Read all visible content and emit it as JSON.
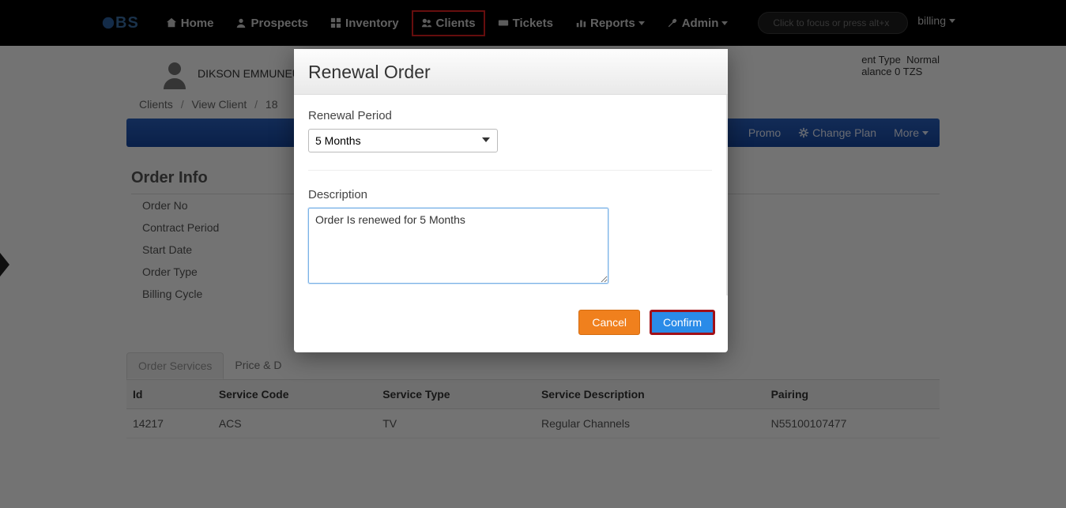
{
  "nav": {
    "logo": "BS",
    "home": "Home",
    "prospects": "Prospects",
    "inventory": "Inventory",
    "clients": "Clients",
    "tickets": "Tickets",
    "reports": "Reports",
    "admin": "Admin",
    "search_placeholder": "Click to focus or press alt+x",
    "user": "billing"
  },
  "client": {
    "name": "DIKSON EMMUNEUL",
    "type_label": "ent Type",
    "type_value": "Normal",
    "balance_label": "alance",
    "balance_value": "0 TZS"
  },
  "breadcrumb": {
    "a": "Clients",
    "b": "View Client",
    "c": "18"
  },
  "actionbar": {
    "promo": "Promo",
    "change_plan": "Change Plan",
    "more": "More"
  },
  "order_info": {
    "title": "Order Info",
    "order_no": "Order No",
    "contract_period": "Contract Period",
    "start_date": "Start Date",
    "order_type": "Order Type",
    "billing_cycle": "Billing Cycle"
  },
  "tabs": {
    "order_services": "Order Services",
    "price_details": "Price & D"
  },
  "table": {
    "headers": {
      "id": "Id",
      "code": "Service Code",
      "type": "Service Type",
      "desc": "Service Description",
      "pairing": "Pairing"
    },
    "row": {
      "id": "14217",
      "code": "ACS",
      "type": "TV",
      "desc": "Regular Channels",
      "pairing": "N55100107477"
    }
  },
  "modal": {
    "title": "Renewal Order",
    "period_label": "Renewal Period",
    "period_value": "5 Months",
    "description_label": "Description",
    "description_value": "Order Is renewed for 5 Months",
    "cancel": "Cancel",
    "confirm": "Confirm"
  }
}
